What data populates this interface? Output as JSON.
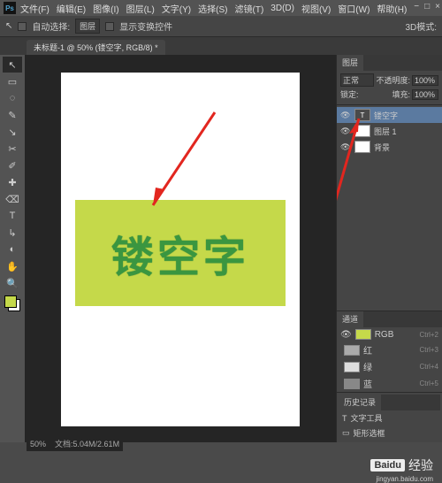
{
  "menu": {
    "items": [
      "文件(F)",
      "编辑(E)",
      "图像(I)",
      "图层(L)",
      "文字(Y)",
      "选择(S)",
      "滤镜(T)",
      "3D(D)",
      "视图(V)",
      "窗口(W)",
      "帮助(H)"
    ]
  },
  "winctrl": [
    "−",
    "□",
    "×"
  ],
  "optbar": {
    "move_icon": "↖",
    "auto_select_label": "自动选择:",
    "auto_select_value": "图层",
    "show_transform": "显示变换控件",
    "mode3d_label": "3D模式:"
  },
  "tab": {
    "title": "未标题-1 @ 50% (镂空字, RGB/8) *"
  },
  "tools": [
    "↖",
    "▭",
    "◌",
    "✎",
    "↘",
    "✂",
    "✐",
    "✚",
    "⌫",
    "T",
    "↳",
    "◐",
    "✋",
    "🔍"
  ],
  "swatch": {
    "fg": "#c5d94a",
    "bg": "#ffffff"
  },
  "canvas": {
    "knockout_text": "镂空字"
  },
  "panels": {
    "layer_tab": "图层",
    "blend_mode": "正常",
    "opacity_label": "不透明度:",
    "opacity_value": "100%",
    "lock_label": "锁定:",
    "fill_label": "填充:",
    "fill_value": "100%",
    "layers": [
      {
        "eye": "👁",
        "name": "镂空字",
        "type": "T",
        "sel": true
      },
      {
        "eye": "👁",
        "name": "图层 1",
        "type": "img",
        "sel": false
      },
      {
        "eye": "👁",
        "name": "背景",
        "type": "bg",
        "sel": false
      }
    ],
    "chan_tab": "通道",
    "channels": [
      {
        "eye": "👁",
        "name": "RGB",
        "sc": "Ctrl+2"
      },
      {
        "eye": "",
        "name": "红",
        "sc": "Ctrl+3"
      },
      {
        "eye": "",
        "name": "绿",
        "sc": "Ctrl+4"
      },
      {
        "eye": "",
        "name": "蓝",
        "sc": "Ctrl+5"
      }
    ],
    "hist_tab": "历史记录",
    "history": [
      {
        "icon": "T",
        "label": "文字工具"
      },
      {
        "icon": "▭",
        "label": "矩形选框"
      }
    ]
  },
  "status": {
    "zoom": "50%",
    "docinfo": "文档:5.04M/2.61M"
  },
  "watermark": {
    "brand": "Baidu",
    "text": "经验",
    "url": "jingyan.baidu.com"
  }
}
